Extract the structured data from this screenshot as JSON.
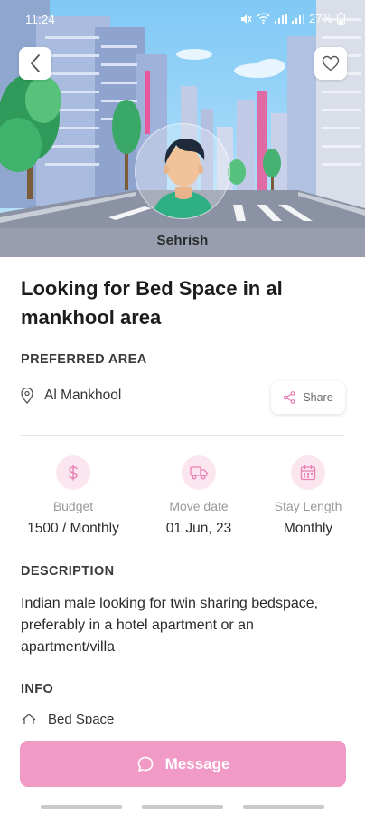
{
  "status_bar": {
    "time": "11:24",
    "battery_text": "27%"
  },
  "hero": {
    "owner_name": "Sehrish"
  },
  "listing": {
    "title": "Looking for Bed Space in al mankhool area",
    "preferred_area_label": "PREFERRED AREA",
    "location": "Al Mankhool",
    "share_label": "Share"
  },
  "stats": [
    {
      "label": "Budget",
      "value": "1500 / Monthly",
      "icon": "dollar-icon"
    },
    {
      "label": "Move date",
      "value": "01 Jun, 23",
      "icon": "truck-icon"
    },
    {
      "label": "Stay Length",
      "value": "Monthly",
      "icon": "calendar-icon"
    }
  ],
  "description": {
    "label": "DESCRIPTION",
    "text": "Indian male looking for twin sharing bedspace, preferably in a hotel apartment or an apartment/villa"
  },
  "info": {
    "label": "INFO",
    "items": [
      "Bed Space"
    ]
  },
  "actions": {
    "message_label": "Message"
  },
  "colors": {
    "accent": "#f19ac6",
    "accent_soft": "#fbe6f0",
    "icon_pink": "#e97fb3"
  }
}
